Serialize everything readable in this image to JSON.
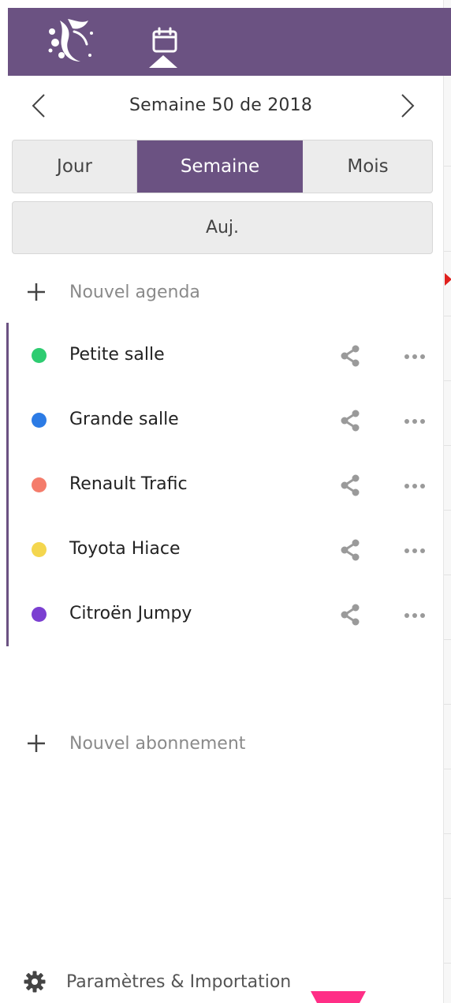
{
  "header": {
    "logo_icon": "hand-logo-icon",
    "calendar_icon": "calendar-icon",
    "bar_color": "#6b5282"
  },
  "week_nav": {
    "title": "Semaine 50 de 2018",
    "prev_icon": "chevron-left-icon",
    "next_icon": "chevron-right-icon"
  },
  "view_switch": {
    "options": [
      "Jour",
      "Semaine",
      "Mois"
    ],
    "selected": "Semaine"
  },
  "today_label": "Auj.",
  "new_calendar_label": "Nouvel agenda",
  "calendars": [
    {
      "name": "Petite salle",
      "color": "#2ecc71"
    },
    {
      "name": "Grande salle",
      "color": "#2c7be5"
    },
    {
      "name": "Renault Trafic",
      "color": "#f47c6b"
    },
    {
      "name": "Toyota Hiace",
      "color": "#f4d64e"
    },
    {
      "name": "Citroën Jumpy",
      "color": "#7b3fd1"
    }
  ],
  "new_subscription_label": "Nouvel abonnement",
  "settings_label": "Paramètres & Importation",
  "accent_pink": "#ff2e86",
  "marker_red": "#e0211e"
}
